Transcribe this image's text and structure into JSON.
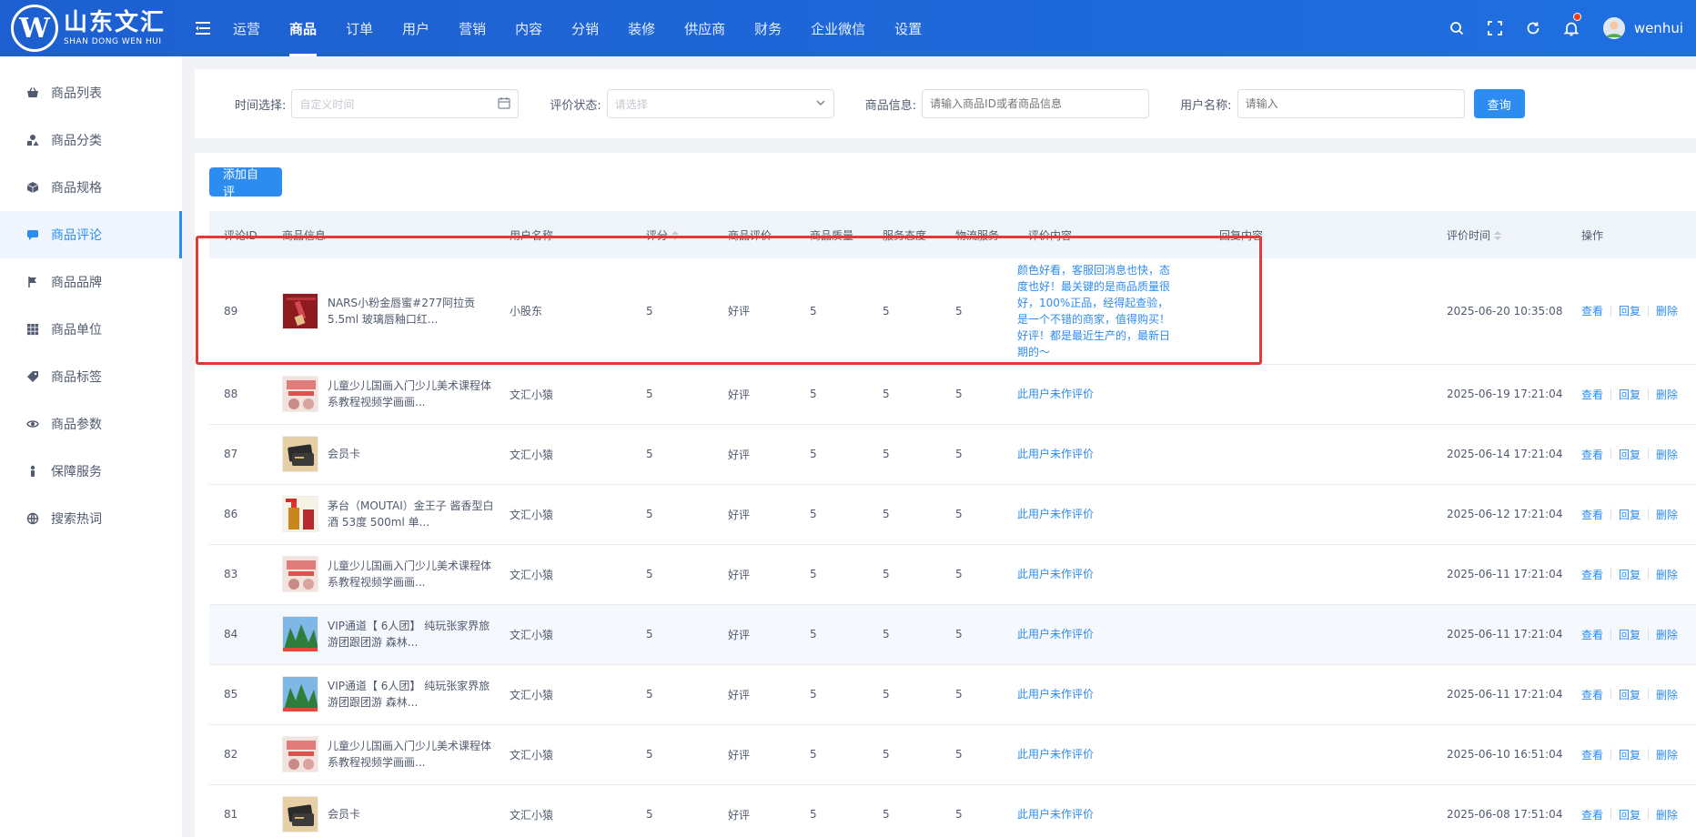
{
  "brand": {
    "cn": "山东文汇",
    "en": "SHAN DONG WEN HUI",
    "mark": "W"
  },
  "nav": [
    "运营",
    "商品",
    "订单",
    "用户",
    "营销",
    "内容",
    "分销",
    "装修",
    "供应商",
    "财务",
    "企业微信",
    "设置"
  ],
  "nav_active": "商品",
  "user": {
    "name": "wenhui"
  },
  "sidebar": {
    "items": [
      {
        "label": "商品列表",
        "icon": "basket-icon"
      },
      {
        "label": "商品分类",
        "icon": "shapes-icon"
      },
      {
        "label": "商品规格",
        "icon": "cube-icon"
      },
      {
        "label": "商品评论",
        "icon": "comment-icon"
      },
      {
        "label": "商品品牌",
        "icon": "flag-icon"
      },
      {
        "label": "商品单位",
        "icon": "grid-icon"
      },
      {
        "label": "商品标签",
        "icon": "tag-icon"
      },
      {
        "label": "商品参数",
        "icon": "eye-icon"
      },
      {
        "label": "保障服务",
        "icon": "person-icon"
      },
      {
        "label": "搜索热词",
        "icon": "search-hot-icon"
      }
    ],
    "active": "商品评论"
  },
  "filters": {
    "time_label": "时间选择:",
    "time_placeholder": "自定义时间",
    "status_label": "评价状态:",
    "status_placeholder": "请选择",
    "product_label": "商品信息:",
    "product_placeholder": "请输入商品ID或者商品信息",
    "user_label": "用户名称:",
    "user_placeholder": "请输入",
    "query_button": "查询"
  },
  "add_button": "添加自评",
  "table": {
    "headers": [
      "评论ID",
      "商品信息",
      "用户名称",
      "评分",
      "商品评价",
      "商品质量",
      "服务态度",
      "物流服务",
      "评价内容",
      "回复内容",
      "评价时间",
      "操作"
    ],
    "actions": [
      "查看",
      "回复",
      "删除"
    ],
    "rows": [
      {
        "id": "89",
        "product": "NARS小粉金唇蜜#277阿拉贡 5.5ml 玻璃唇釉口红...",
        "user": "小股东",
        "score": "5",
        "rating": "好评",
        "quality": "5",
        "service": "5",
        "logistics": "5",
        "content": "颜色好看，客服回消息也快，态度也好！最关键的是商品质量很好，100%正品，经得起查验，是一个不错的商家，值得购买！好评！都是最近生产的，最新日期的～",
        "reply": "",
        "time": "2025-06-20 10:35:08",
        "thumb": "lipstick"
      },
      {
        "id": "88",
        "product": "儿童少儿国画入门少儿美术课程体系教程视频学画画...",
        "user": "文汇小猿",
        "score": "5",
        "rating": "好评",
        "quality": "5",
        "service": "5",
        "logistics": "5",
        "content": "此用户未作评价",
        "reply": "",
        "time": "2025-06-19 17:21:04",
        "thumb": "painting"
      },
      {
        "id": "87",
        "product": "会员卡",
        "user": "文汇小猿",
        "score": "5",
        "rating": "好评",
        "quality": "5",
        "service": "5",
        "logistics": "5",
        "content": "此用户未作评价",
        "reply": "",
        "time": "2025-06-14 17:21:04",
        "thumb": "card"
      },
      {
        "id": "86",
        "product": "茅台（MOUTAI）金王子 酱香型白酒 53度 500ml 单...",
        "user": "文汇小猿",
        "score": "5",
        "rating": "好评",
        "quality": "5",
        "service": "5",
        "logistics": "5",
        "content": "此用户未作评价",
        "reply": "",
        "time": "2025-06-12 17:21:04",
        "thumb": "liquor"
      },
      {
        "id": "83",
        "product": "儿童少儿国画入门少儿美术课程体系教程视频学画画...",
        "user": "文汇小猿",
        "score": "5",
        "rating": "好评",
        "quality": "5",
        "service": "5",
        "logistics": "5",
        "content": "此用户未作评价",
        "reply": "",
        "time": "2025-06-11 17:21:04",
        "thumb": "painting"
      },
      {
        "id": "84",
        "product": "VIP通道【 6人团】 纯玩张家界旅游团跟团游 森林...",
        "user": "文汇小猿",
        "score": "5",
        "rating": "好评",
        "quality": "5",
        "service": "5",
        "logistics": "5",
        "content": "此用户未作评价",
        "reply": "",
        "time": "2025-06-11 17:21:04",
        "thumb": "travel"
      },
      {
        "id": "85",
        "product": "VIP通道【 6人团】 纯玩张家界旅游团跟团游 森林...",
        "user": "文汇小猿",
        "score": "5",
        "rating": "好评",
        "quality": "5",
        "service": "5",
        "logistics": "5",
        "content": "此用户未作评价",
        "reply": "",
        "time": "2025-06-11 17:21:04",
        "thumb": "travel"
      },
      {
        "id": "82",
        "product": "儿童少儿国画入门少儿美术课程体系教程视频学画画...",
        "user": "文汇小猿",
        "score": "5",
        "rating": "好评",
        "quality": "5",
        "service": "5",
        "logistics": "5",
        "content": "此用户未作评价",
        "reply": "",
        "time": "2025-06-10 16:51:04",
        "thumb": "painting"
      },
      {
        "id": "81",
        "product": "会员卡",
        "user": "文汇小猿",
        "score": "5",
        "rating": "好评",
        "quality": "5",
        "service": "5",
        "logistics": "5",
        "content": "此用户未作评价",
        "reply": "",
        "time": "2025-06-08 17:51:04",
        "thumb": "card"
      }
    ]
  },
  "colors": {
    "header": "#1f66d8",
    "primary": "#2d8cf0",
    "highlight": "#e53935"
  }
}
